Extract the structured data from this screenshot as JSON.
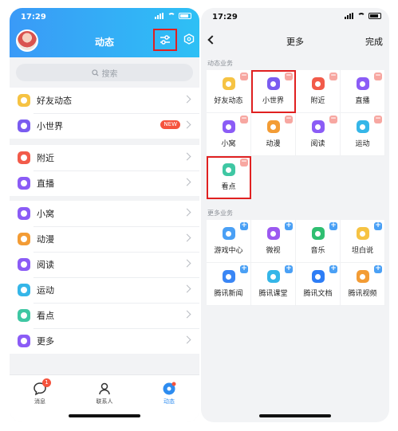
{
  "left": {
    "status_time": "17:29",
    "title": "动态",
    "search_placeholder": "搜索",
    "groups": [
      [
        {
          "label": "好友动态",
          "color": "#f6c343",
          "icon": "friend-feed-icon"
        },
        {
          "label": "小世界",
          "color": "#7a5cf0",
          "icon": "small-world-icon",
          "badge": "NEW"
        }
      ],
      [
        {
          "label": "附近",
          "color": "#f25b4a",
          "icon": "nearby-icon"
        },
        {
          "label": "直播",
          "color": "#8b5cf6",
          "icon": "live-icon"
        }
      ],
      [
        {
          "label": "小窝",
          "color": "#8b5cf6",
          "icon": "nest-icon"
        },
        {
          "label": "动漫",
          "color": "#f39c35",
          "icon": "anime-icon"
        },
        {
          "label": "阅读",
          "color": "#8b5cf6",
          "icon": "reading-icon"
        },
        {
          "label": "运动",
          "color": "#35b6e8",
          "icon": "sports-icon"
        },
        {
          "label": "看点",
          "color": "#3fc7a3",
          "icon": "kandian-icon"
        },
        {
          "label": "更多",
          "color": "#8b5cf6",
          "icon": "more-grid-icon"
        }
      ]
    ],
    "nav": [
      {
        "label": "消息",
        "badge": "1",
        "icon": "message-icon"
      },
      {
        "label": "联系人",
        "icon": "contacts-icon"
      },
      {
        "label": "动态",
        "icon": "feed-icon",
        "active": true
      }
    ],
    "colors": {
      "header_start": "#3a9af7",
      "header_end": "#2ec0f5",
      "highlight": "#e02020"
    }
  },
  "right": {
    "status_time": "17:29",
    "title": "更多",
    "done_label": "完成",
    "section1_title": "动态业务",
    "section1": [
      {
        "label": "好友动态",
        "color": "#f6c343",
        "icon": "friend-feed-icon",
        "corner": "−"
      },
      {
        "label": "小世界",
        "color": "#7a5cf0",
        "icon": "small-world-icon",
        "corner": "−",
        "highlight": true
      },
      {
        "label": "附近",
        "color": "#f25b4a",
        "icon": "nearby-icon",
        "corner": "−"
      },
      {
        "label": "直播",
        "color": "#8b5cf6",
        "icon": "live-icon",
        "corner": "−"
      },
      {
        "label": "小窝",
        "color": "#8b5cf6",
        "icon": "nest-icon",
        "corner": "−"
      },
      {
        "label": "动漫",
        "color": "#f39c35",
        "icon": "anime-icon",
        "corner": "−"
      },
      {
        "label": "阅读",
        "color": "#8b5cf6",
        "icon": "reading-icon",
        "corner": "−"
      },
      {
        "label": "运动",
        "color": "#35b6e8",
        "icon": "sports-icon",
        "corner": "−"
      },
      {
        "label": "看点",
        "color": "#3fc7a3",
        "icon": "kandian-icon",
        "corner": "−",
        "highlight": true
      }
    ],
    "section2_title": "更多业务",
    "section2": [
      {
        "label": "游戏中心",
        "color": "#4aa0f5",
        "icon": "game-center-icon",
        "corner": "+"
      },
      {
        "label": "微视",
        "color": "#9b59f0",
        "icon": "weishi-icon",
        "corner": "+"
      },
      {
        "label": "音乐",
        "color": "#2fbf71",
        "icon": "music-icon",
        "corner": "+"
      },
      {
        "label": "坦白说",
        "color": "#f6c343",
        "icon": "confess-icon",
        "corner": "+"
      },
      {
        "label": "腾讯新闻",
        "color": "#3a86f5",
        "icon": "news-icon",
        "corner": "+"
      },
      {
        "label": "腾讯课堂",
        "color": "#35b6e8",
        "icon": "classroom-icon",
        "corner": "+"
      },
      {
        "label": "腾讯文档",
        "color": "#2d7df6",
        "icon": "docs-icon",
        "corner": "+"
      },
      {
        "label": "腾讯视频",
        "color": "#f39c35",
        "icon": "video-icon",
        "corner": "+"
      }
    ]
  }
}
